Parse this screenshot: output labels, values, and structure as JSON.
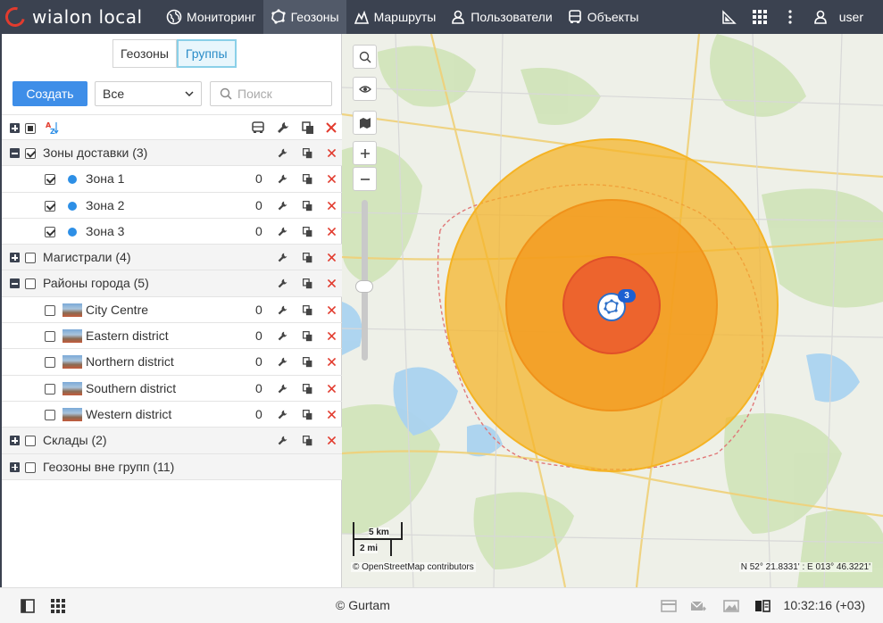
{
  "app": {
    "logo_text": "wialon local"
  },
  "nav": [
    {
      "label": "Мониторинг",
      "icon": "globe-icon",
      "active": false
    },
    {
      "label": "Геозоны",
      "icon": "geofence-icon",
      "active": true
    },
    {
      "label": "Маршруты",
      "icon": "route-icon",
      "active": false
    },
    {
      "label": "Пользователи",
      "icon": "user-icon",
      "active": false
    },
    {
      "label": "Объекты",
      "icon": "bus-icon",
      "active": false
    }
  ],
  "user": {
    "name": "user"
  },
  "panel": {
    "tabs": [
      {
        "label": "Геозоны",
        "active": false
      },
      {
        "label": "Группы",
        "active": true
      }
    ],
    "create_label": "Создать",
    "filter_value": "Все",
    "search_placeholder": "Поиск",
    "groups": [
      {
        "label": "Зоны доставки (3)",
        "expanded": true,
        "checked": true,
        "items": [
          {
            "label": "Зона 1",
            "count": "0",
            "checked": true,
            "kind": "dot"
          },
          {
            "label": "Зона 2",
            "count": "0",
            "checked": true,
            "kind": "dot"
          },
          {
            "label": "Зона 3",
            "count": "0",
            "checked": true,
            "kind": "dot"
          }
        ]
      },
      {
        "label": "Магистрали (4)",
        "expanded": false,
        "checked": false,
        "items": []
      },
      {
        "label": "Районы города (5)",
        "expanded": true,
        "checked": false,
        "items": [
          {
            "label": "City Centre",
            "count": "0",
            "checked": false,
            "kind": "thumb"
          },
          {
            "label": "Eastern district",
            "count": "0",
            "checked": false,
            "kind": "thumb"
          },
          {
            "label": "Northern district",
            "count": "0",
            "checked": false,
            "kind": "thumb"
          },
          {
            "label": "Southern district",
            "count": "0",
            "checked": false,
            "kind": "thumb"
          },
          {
            "label": "Western district",
            "count": "0",
            "checked": false,
            "kind": "thumb"
          }
        ]
      },
      {
        "label": "Склады (2)",
        "expanded": false,
        "checked": false,
        "items": []
      },
      {
        "label": "Геозоны вне групп (11)",
        "expanded": false,
        "checked": false,
        "items": [],
        "no_actions": true
      }
    ]
  },
  "map": {
    "scale_km": "5 km",
    "scale_mi": "2 mi",
    "attribution": "© OpenStreetMap contributors",
    "coords": "N 52° 21.8331' : E 013° 46.3221'",
    "marker_badge": "3",
    "zone_colors": {
      "outer": "#f5b324",
      "middle": "#f39a1e",
      "inner": "#ec5b2e"
    }
  },
  "footer": {
    "copyright": "© Gurtam",
    "clock": "10:32:16 (+03)"
  }
}
